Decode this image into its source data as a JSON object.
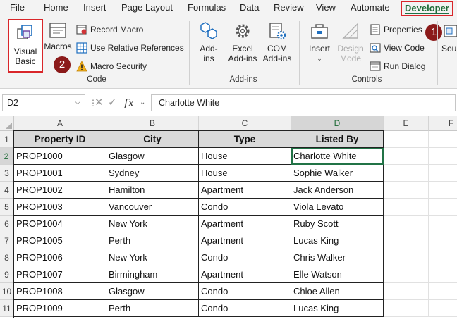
{
  "tabs": [
    "File",
    "Home",
    "Insert",
    "Page Layout",
    "Formulas",
    "Data",
    "Review",
    "View",
    "Automate",
    "Developer"
  ],
  "active_tab": "Developer",
  "ribbon": {
    "code": {
      "visual_basic_line1": "Visual",
      "visual_basic_line2": "Basic",
      "macros": "Macros",
      "record_macro": "Record Macro",
      "relative_refs": "Use Relative References",
      "macro_security": "Macro Security",
      "label": "Code"
    },
    "addins": {
      "addins_line1": "Add-",
      "addins_line2": "ins",
      "excel_line1": "Excel",
      "excel_line2": "Add-ins",
      "com_line1": "COM",
      "com_line2": "Add-ins",
      "label": "Add-ins"
    },
    "controls": {
      "insert": "Insert",
      "design_line1": "Design",
      "design_line2": "Mode",
      "properties": "Properties",
      "view_code": "View Code",
      "run_dialog": "Run Dialog",
      "label": "Controls"
    },
    "source_partial": "Sou",
    "badges": [
      "1",
      "2"
    ]
  },
  "formula_bar": {
    "name_box": "D2",
    "formula": "Charlotte White",
    "fx": "fx"
  },
  "grid": {
    "columns": [
      "A",
      "B",
      "C",
      "D",
      "E",
      "F"
    ],
    "rows": [
      "1",
      "2",
      "3",
      "4",
      "5",
      "6",
      "7",
      "8",
      "9",
      "10",
      "11"
    ],
    "header": [
      "Property ID",
      "City",
      "Type",
      "Listed By"
    ],
    "data": [
      [
        "PROP1000",
        "Glasgow",
        "House",
        "Charlotte White"
      ],
      [
        "PROP1001",
        "Sydney",
        "House",
        "Sophie Walker"
      ],
      [
        "PROP1002",
        "Hamilton",
        "Apartment",
        "Jack Anderson"
      ],
      [
        "PROP1003",
        "Vancouver",
        "Condo",
        "Viola Levato"
      ],
      [
        "PROP1004",
        "New York",
        "Apartment",
        "Ruby Scott"
      ],
      [
        "PROP1005",
        "Perth",
        "Apartment",
        "Lucas King"
      ],
      [
        "PROP1006",
        "New York",
        "Condo",
        "Chris Walker"
      ],
      [
        "PROP1007",
        "Birmingham",
        "Apartment",
        "Elle Watson"
      ],
      [
        "PROP1008",
        "Glasgow",
        "Condo",
        "Chloe Allen"
      ],
      [
        "PROP1009",
        "Perth",
        "Condo",
        "Lucas King"
      ]
    ],
    "selected_cell": "D2"
  }
}
